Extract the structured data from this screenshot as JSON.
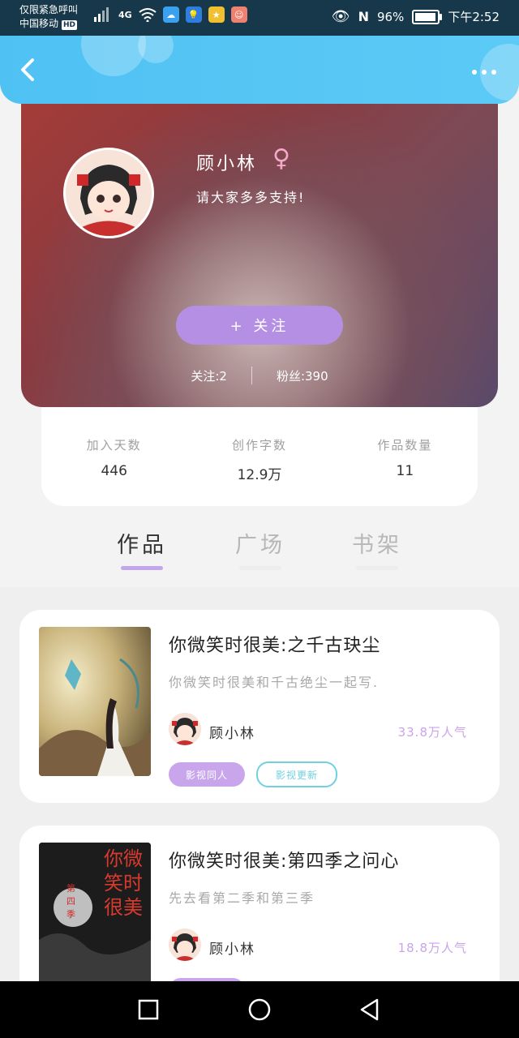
{
  "status_bar": {
    "emergency_text": "仅限紧急呼叫",
    "carrier": "中国移动",
    "carrier_badge": "HD",
    "network": "4G",
    "battery": "96%",
    "battery_level": 0.96,
    "time": "下午2:52"
  },
  "header": {
    "back_icon": "chevron-left-icon",
    "more_icon": "more-dots-icon"
  },
  "profile": {
    "name": "顾小林",
    "gender_symbol": "♀",
    "bio": "请大家多多支持!",
    "follow_label": "+   关注",
    "following": "关注:2",
    "fans": "粉丝:390"
  },
  "stats": [
    {
      "label": "加入天数",
      "value": "446"
    },
    {
      "label": "创作字数",
      "value": "12.9万"
    },
    {
      "label": "作品数量",
      "value": "11"
    }
  ],
  "tabs": [
    {
      "label": "作品",
      "active": true
    },
    {
      "label": "广场",
      "active": false
    },
    {
      "label": "书架",
      "active": false
    }
  ],
  "works": [
    {
      "title": "你微笑时很美:之千古玦尘",
      "desc": "你微笑时很美和千古绝尘一起写.",
      "author": "顾小林",
      "popularity": "33.8万人气",
      "tags": [
        "影视同人",
        "影视更新"
      ]
    },
    {
      "title": "你微笑时很美:第四季之问心",
      "desc": "先去看第二季和第三季",
      "author": "顾小林",
      "popularity": "18.8万人气",
      "cover_text": [
        "你微",
        "笑时",
        "很美"
      ],
      "cover_side": [
        "第",
        "四",
        "季"
      ]
    }
  ],
  "colors": {
    "header": "#4fc1f3",
    "accent_purple": "#b48fe3",
    "tag_cyan": "#6fd1e0"
  }
}
